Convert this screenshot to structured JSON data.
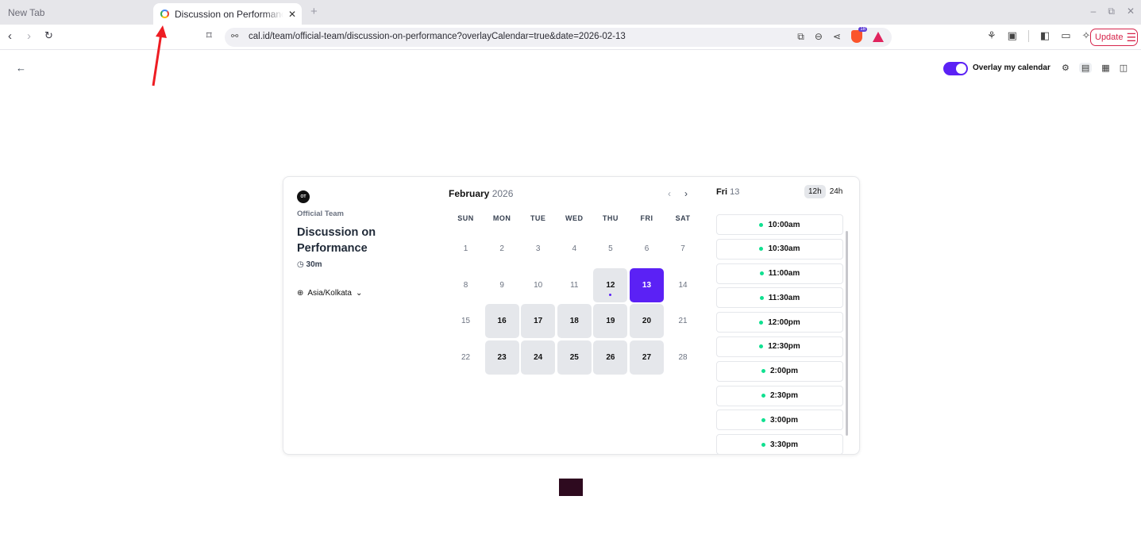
{
  "browser": {
    "inactive_tab": "New Tab",
    "active_tab": "Discussion on Performance",
    "url": "cal.id/team/official-team/discussion-on-performance?overlayCalendar=true&date=2026-02-13",
    "update_label": "Update"
  },
  "toolbar": {
    "overlay_label": "Overlay my calendar",
    "overlay_on": true
  },
  "event": {
    "avatar_initials": "OT",
    "team": "Official Team",
    "title": "Discussion on Performance",
    "duration": "30m",
    "timezone": "Asia/Kolkata"
  },
  "calendar": {
    "month": "February",
    "year": "2026",
    "weekdays": [
      "SUN",
      "MON",
      "TUE",
      "WED",
      "THU",
      "FRI",
      "SAT"
    ],
    "days": [
      {
        "n": "1",
        "state": "off"
      },
      {
        "n": "2",
        "state": "off"
      },
      {
        "n": "3",
        "state": "off"
      },
      {
        "n": "4",
        "state": "off"
      },
      {
        "n": "5",
        "state": "off"
      },
      {
        "n": "6",
        "state": "off"
      },
      {
        "n": "7",
        "state": "off"
      },
      {
        "n": "8",
        "state": "off"
      },
      {
        "n": "9",
        "state": "off"
      },
      {
        "n": "10",
        "state": "off"
      },
      {
        "n": "11",
        "state": "off"
      },
      {
        "n": "12",
        "state": "today"
      },
      {
        "n": "13",
        "state": "selected"
      },
      {
        "n": "14",
        "state": "off"
      },
      {
        "n": "15",
        "state": "off"
      },
      {
        "n": "16",
        "state": "available"
      },
      {
        "n": "17",
        "state": "available"
      },
      {
        "n": "18",
        "state": "available"
      },
      {
        "n": "19",
        "state": "available"
      },
      {
        "n": "20",
        "state": "available"
      },
      {
        "n": "21",
        "state": "off"
      },
      {
        "n": "22",
        "state": "off"
      },
      {
        "n": "23",
        "state": "available"
      },
      {
        "n": "24",
        "state": "available"
      },
      {
        "n": "25",
        "state": "available"
      },
      {
        "n": "26",
        "state": "available"
      },
      {
        "n": "27",
        "state": "available"
      },
      {
        "n": "28",
        "state": "off"
      }
    ]
  },
  "slots": {
    "day_label": "Fri",
    "day_num": "13",
    "format_12": "12h",
    "format_24": "24h",
    "times": [
      "10:00am",
      "10:30am",
      "11:00am",
      "11:30am",
      "12:00pm",
      "12:30pm",
      "2:00pm",
      "2:30pm",
      "3:00pm",
      "3:30pm"
    ]
  },
  "colors": {
    "brand": "#5b21f5",
    "available_dot": "#10e090"
  }
}
